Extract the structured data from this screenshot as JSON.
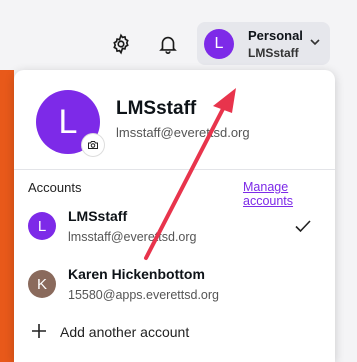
{
  "header": {
    "settings_icon": "gear-icon",
    "notifications_icon": "bell-icon",
    "account_switcher": {
      "avatar_initial": "L",
      "name": "Personal",
      "subname": "LMSstaff",
      "chevron_icon": "chevron-down-icon"
    }
  },
  "profile": {
    "avatar_initial": "L",
    "name": "LMSstaff",
    "email": "lmsstaff@everettsd.org",
    "badge_icon": "camera-icon"
  },
  "accounts": {
    "label": "Accounts",
    "manage_link": "Manage accounts",
    "items": [
      {
        "initial": "L",
        "name": "LMSstaff",
        "email": "lmsstaff@everettsd.org",
        "selected": true,
        "color": "#7d2ae8"
      },
      {
        "initial": "K",
        "name": "Karen Hickenbottom",
        "email": "15580@apps.everettsd.org",
        "selected": false,
        "color": "#8a6a5c"
      }
    ],
    "add_label": "Add another account"
  },
  "colors": {
    "accent": "#7d2ae8",
    "annotation_arrow": "#e8344c",
    "side_strip": "#e8591a"
  }
}
